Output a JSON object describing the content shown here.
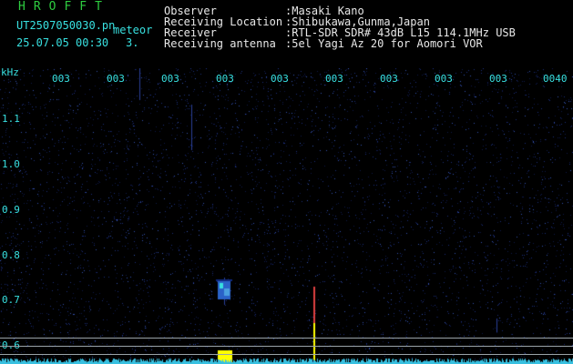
{
  "header": {
    "program": "HROFFT",
    "filename": "UT2507050030.pn",
    "mode": "meteor",
    "date_time": "25.07.05 00:30",
    "index": "3.",
    "info_labels": [
      "Observer",
      "Receiving Location",
      "Receiver",
      "Receiving antenna"
    ],
    "info_values": [
      ":Masaki Kano",
      ":Shibukawa,Gunma,Japan",
      ":RTL-SDR SDR# 43dB L15 114.1MHz USB",
      ":5el Yagi Az 20 for Aomori VOR"
    ]
  },
  "colors": {
    "background": "#000000",
    "label_cyan": "#38e0e0",
    "title_green": "#2ecc40",
    "signal_yellow": "#ffff00",
    "noise_blue": "#1f3a8a",
    "grid_gray": "#9aa3a8"
  },
  "axis": {
    "y_unit": "kHz",
    "y_ticks": [
      "1.1",
      "1.0",
      "0.9",
      "0.8",
      "0.7",
      "0.6"
    ],
    "x_ticks": [
      "003",
      "003",
      "003",
      "003",
      "003",
      "003",
      "003",
      "003",
      "003",
      "0040"
    ]
  }
}
